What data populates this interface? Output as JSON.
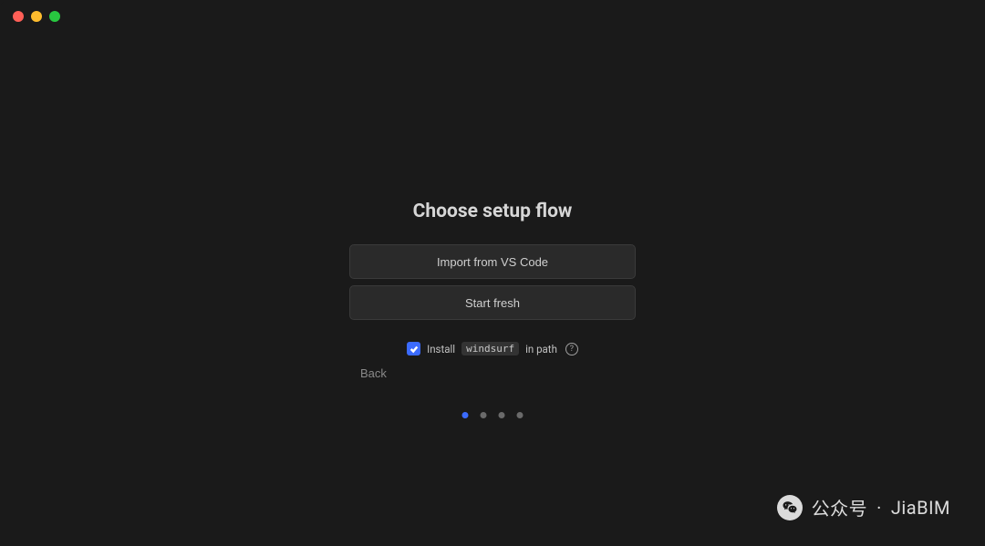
{
  "title": "Choose setup flow",
  "options": {
    "import": "Import from VS Code",
    "fresh": "Start fresh"
  },
  "install": {
    "checked": true,
    "label_prefix": "Install",
    "command": "windsurf",
    "label_suffix": "in path"
  },
  "nav": {
    "back": "Back"
  },
  "progress": {
    "active_index": 0,
    "total": 4
  },
  "watermark": {
    "source_label": "公众号",
    "separator": "·",
    "name": "JiaBIM"
  }
}
